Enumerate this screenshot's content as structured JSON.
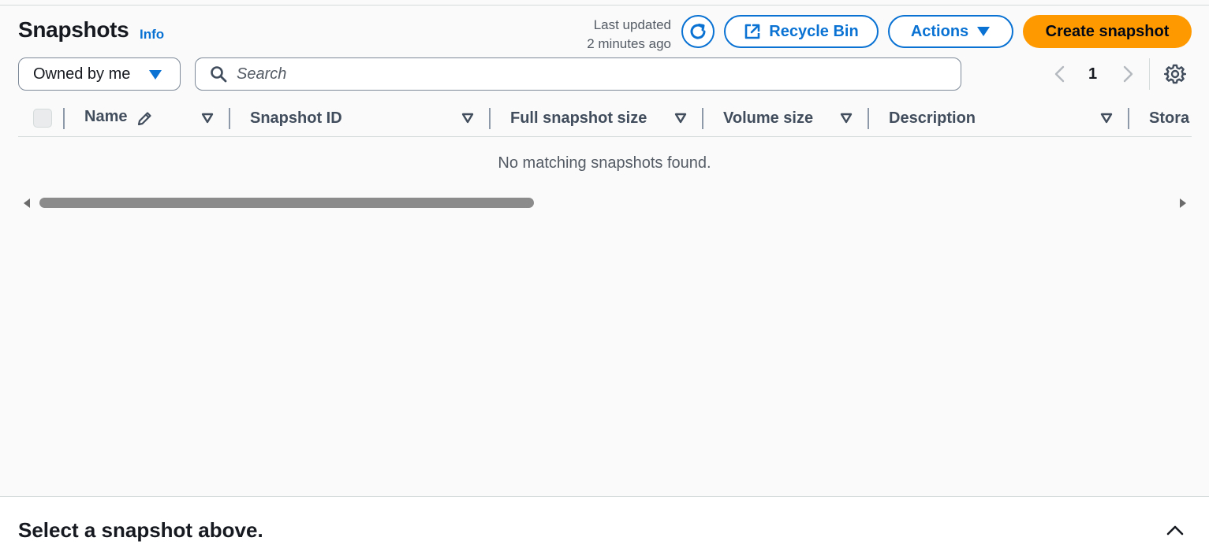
{
  "header": {
    "title": "Snapshots",
    "info_label": "Info",
    "last_updated_line1": "Last updated",
    "last_updated_line2": "2 minutes ago",
    "refresh_icon": "refresh-icon",
    "recycle_bin_label": "Recycle Bin",
    "recycle_bin_icon": "external-link-icon",
    "actions_label": "Actions",
    "create_label": "Create snapshot"
  },
  "filters": {
    "owner_selected": "Owned by me",
    "search_placeholder": "Search"
  },
  "pagination": {
    "current_page": "1"
  },
  "table": {
    "columns": [
      {
        "label": "Name",
        "editable": true
      },
      {
        "label": "Snapshot ID"
      },
      {
        "label": "Full snapshot size"
      },
      {
        "label": "Volume size"
      },
      {
        "label": "Description"
      },
      {
        "label": "Stora"
      }
    ],
    "rows": [],
    "empty_message": "No matching snapshots found."
  },
  "split_panel": {
    "title": "Select a snapshot above."
  },
  "colors": {
    "accent": "#0972d3",
    "primary_button": "#ff9900",
    "border": "#7d8998",
    "background": "#fafafa"
  }
}
